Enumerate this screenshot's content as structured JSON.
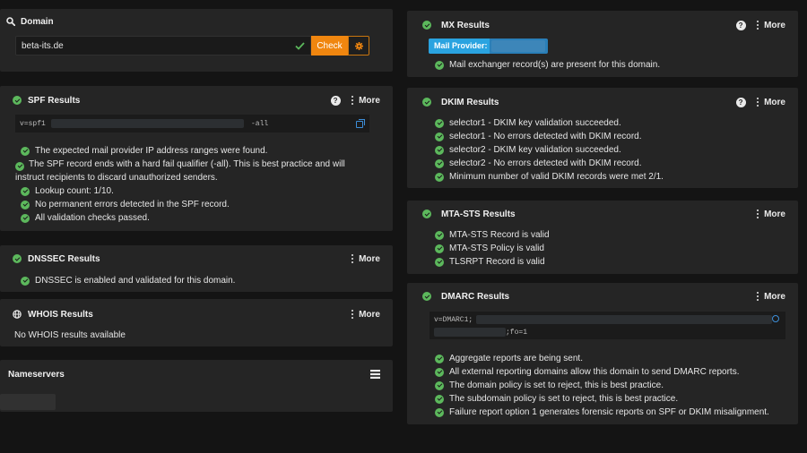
{
  "domain": {
    "title": "Domain",
    "input_value": "beta-its.de",
    "check_label": "Check"
  },
  "spf": {
    "title": "SPF Results",
    "more_label": "More",
    "record_prefix": "v=spf1",
    "record_suffix": "-all",
    "lines": [
      "The expected mail provider IP address ranges were found.",
      "The SPF record ends with a hard fail qualifier (-all). This is best practice and will instruct recipients to discard unauthorized senders.",
      "Lookup count: 1/10.",
      "No permanent errors detected in the SPF record.",
      "All validation checks passed."
    ]
  },
  "dnssec": {
    "title": "DNSSEC Results",
    "more_label": "More",
    "lines": [
      "DNSSEC is enabled and validated for this domain."
    ]
  },
  "whois": {
    "title": "WHOIS Results",
    "more_label": "More",
    "empty_text": "No WHOIS results available"
  },
  "nameservers": {
    "title": "Nameservers"
  },
  "mx": {
    "title": "MX Results",
    "more_label": "More",
    "provider_label": "Mail Provider:",
    "lines": [
      "Mail exchanger record(s) are present for this domain."
    ]
  },
  "dkim": {
    "title": "DKIM Results",
    "more_label": "More",
    "lines": [
      "selector1 - DKIM key validation succeeded.",
      "selector1 - No errors detected with DKIM record.",
      "selector2 - DKIM key validation succeeded.",
      "selector2 - No errors detected with DKIM record.",
      "Minimum number of valid DKIM records were met 2/1."
    ]
  },
  "mtasts": {
    "title": "MTA-STS Results",
    "more_label": "More",
    "lines": [
      "MTA-STS Record is valid",
      "MTA-STS Policy is valid",
      "TLSRPT Record is valid"
    ]
  },
  "dmarc": {
    "title": "DMARC Results",
    "more_label": "More",
    "record_prefix": "v=DMARC1;",
    "record_suffix": ";fo=1",
    "lines": [
      "Aggregate reports are being sent.",
      "All external reporting domains allow this domain to send DMARC reports.",
      "The domain policy is set to reject, this is best practice.",
      "The subdomain policy is set to reject, this is best practice.",
      "Failure report option 1 generates forensic reports on SPF or DKIM misalignment."
    ]
  },
  "colors": {
    "success": "#5cb85c",
    "accent": "#f0860f",
    "provider_badge": "#2aa3e0"
  }
}
